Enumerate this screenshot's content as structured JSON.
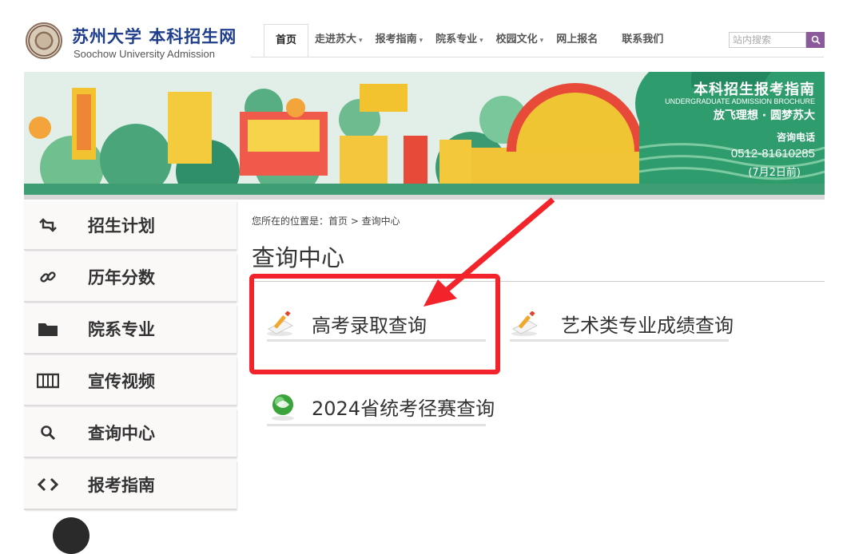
{
  "header": {
    "logo_cn": "苏州大学 本科招生网",
    "logo_en": "Soochow University Admission",
    "nav": [
      {
        "label": "首页",
        "dropdown": false,
        "active": true
      },
      {
        "label": "走进苏大",
        "dropdown": true
      },
      {
        "label": "报考指南",
        "dropdown": true
      },
      {
        "label": "院系专业",
        "dropdown": true
      },
      {
        "label": "校园文化",
        "dropdown": true
      },
      {
        "label": "网上报名",
        "dropdown": false
      },
      {
        "label": "联系我们",
        "dropdown": false
      }
    ],
    "search": {
      "placeholder": "站内搜索",
      "button_icon": "search-icon"
    }
  },
  "banner": {
    "title": "本科招生报考指南",
    "subtitle": "UNDERGRADUATE ADMISSION BROCHURE",
    "slogan": "放飞理想 · 圆梦苏大",
    "phone_label": "咨询电话",
    "phone": "0512-81610285",
    "phone_note": "(7月2日前)"
  },
  "sidebar": {
    "items": [
      {
        "label": "招生计划",
        "icon": "retweet-icon"
      },
      {
        "label": "历年分数",
        "icon": "link-icon"
      },
      {
        "label": "院系专业",
        "icon": "folder-icon"
      },
      {
        "label": "宣传视频",
        "icon": "film-icon"
      },
      {
        "label": "查询中心",
        "icon": "search-icon"
      },
      {
        "label": "报考指南",
        "icon": "code-icon"
      }
    ]
  },
  "main": {
    "breadcrumb": "您所在的位置是：首页 > 查询中心",
    "title": "查询中心",
    "queries": [
      {
        "label": "高考录取查询",
        "icon": "pencil-paper-icon"
      },
      {
        "label": "艺术类专业成绩查询",
        "icon": "pencil-paper-icon"
      },
      {
        "label": "2024省统考径赛查询",
        "icon": "green-globe-icon"
      }
    ]
  },
  "colors": {
    "highlight": "#f2232a",
    "search_button": "#8a5a9a",
    "logo_text": "#1f3e8c"
  }
}
